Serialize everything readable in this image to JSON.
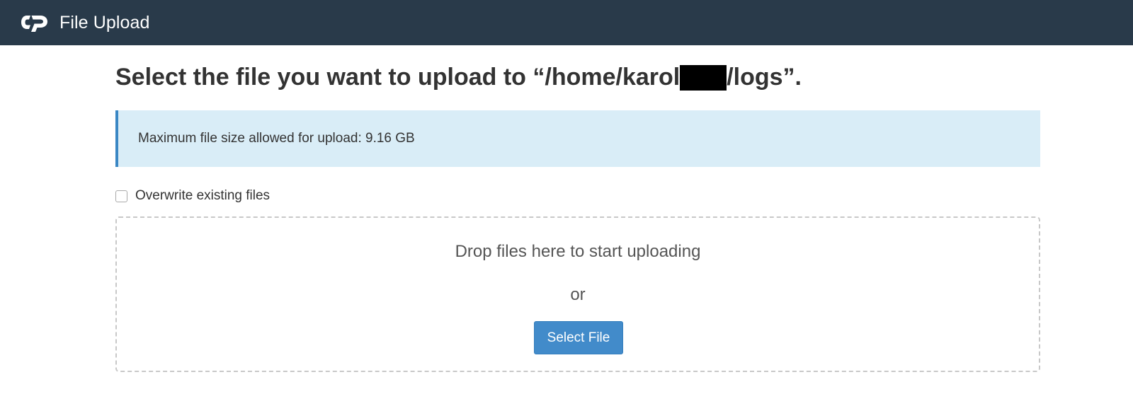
{
  "header": {
    "logo_icon": "cpanel-logo-icon",
    "title": "File Upload",
    "background_color": "#293a4a"
  },
  "main": {
    "heading_prefix": "Select the file you want to upload to “/home/karol",
    "heading_suffix": "/logs”.",
    "info_message": "Maximum file size allowed for upload: 9.16 GB",
    "overwrite_label": "Overwrite existing files",
    "overwrite_checked": false,
    "dropzone": {
      "drop_text": "Drop files here to start uploading",
      "or_text": "or",
      "select_button_label": "Select File"
    },
    "accent_color": "#428bca",
    "info_background": "#d9edf7"
  }
}
